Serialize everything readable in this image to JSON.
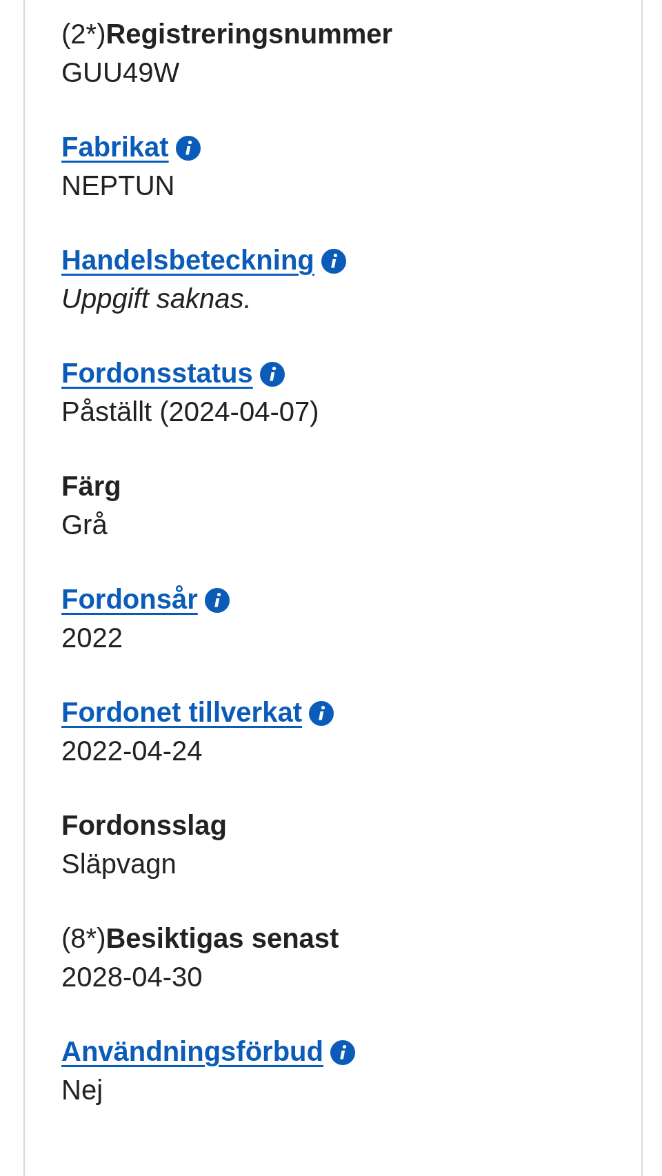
{
  "fields": [
    {
      "kind": "plain",
      "prefix": "(2*)",
      "label": "Registreringsnummer",
      "value": "GUU49W",
      "missing": false
    },
    {
      "kind": "link",
      "label": "Fabrikat",
      "value": "NEPTUN",
      "missing": false
    },
    {
      "kind": "link",
      "label": "Handelsbeteckning",
      "value": "Uppgift saknas.",
      "missing": true
    },
    {
      "kind": "link",
      "label": "Fordonsstatus",
      "value": "Påställt (2024-04-07)",
      "missing": false
    },
    {
      "kind": "plain",
      "label": "Färg",
      "value": "Grå",
      "missing": false
    },
    {
      "kind": "link",
      "label": "Fordonsår",
      "value": "2022",
      "missing": false
    },
    {
      "kind": "link",
      "label": "Fordonet tillverkat",
      "value": "2022-04-24",
      "missing": false
    },
    {
      "kind": "plain",
      "label": "Fordonsslag",
      "value": "Släpvagn",
      "missing": false
    },
    {
      "kind": "plain",
      "prefix": "(8*)",
      "label": "Besiktigas senast",
      "value": "2028-04-30",
      "missing": false
    },
    {
      "kind": "link",
      "label": "Användningsförbud",
      "value": "Nej",
      "missing": false
    }
  ]
}
